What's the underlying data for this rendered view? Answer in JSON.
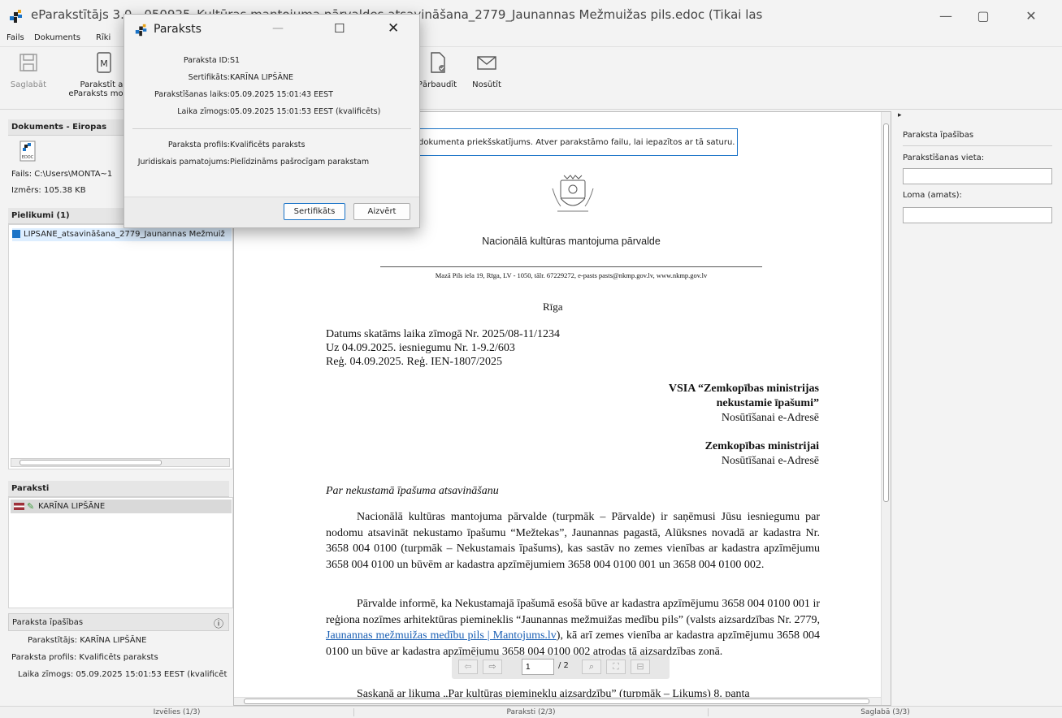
{
  "window": {
    "title": "eParakstītājs 3.0 - 050925_Kultūras mantojuma pārvaldes atsavināšana_2779_Jaunannas Mežmuižas pils.edoc (Tikai lasāms)"
  },
  "menu": [
    "Fails",
    "Dokuments",
    "Rīki"
  ],
  "toolbar": {
    "save": "Saglabāt",
    "sign_line1": "Parakstīt ar",
    "sign_line2": "eParaksts mobile",
    "verify": "Pārbaudīt",
    "send": "Nosūtīt"
  },
  "left": {
    "doc_header": "Dokuments - Eiropas",
    "file_label": "Fails:",
    "file_value": "C:\\Users\\MONTA~1",
    "size_label": "Izmērs:",
    "size_value": "105.38 KB",
    "attachments_header": "Pielikumi (1)",
    "attachment_file": "LIPSANE_atsavināšana_2779_Jaunannas Mežmuiž",
    "signatures_header": "Paraksti",
    "signer": "KARĪNA LIPŠĀNE",
    "props_header": "Paraksta īpašības",
    "props": [
      {
        "label": "Parakstītājs:",
        "value": "KARĪNA LIPŠĀNE"
      },
      {
        "label": "Paraksta profils:",
        "value": "Kvalificēts paraksts"
      },
      {
        "label": "Laika zīmogs:",
        "value": "05.09.2025 15:01:53 EEST (kvalificēt"
      }
    ]
  },
  "doc": {
    "banner": "dokumenta priekšskatījums. Atver parakstāmo failu, lai iepazītos ar tā saturu.",
    "org": "Nacionālā kultūras mantojuma pārvalde",
    "address": "Mazā Pils iela 19, Rīga, LV - 1050, tālr. 67229272, e-pasts pasts@nkmp.gov.lv, www.nkmp.gov.lv",
    "city": "Rīga",
    "date_line": "Datums skatāms laika zīmogā Nr. 2025/08-11/1234",
    "ref1": "Uz 04.09.2025. iesniegumu  Nr. 1-9.2/603",
    "ref2": "Reģ. 04.09.2025. Reģ. IEN-1807/2025",
    "recipient1_line1": "VSIA “Zemkopības ministrijas",
    "recipient1_line2": "nekustamie īpašumi”",
    "recipient1_line3": "Nosūtīšanai e-Adresē",
    "recipient2_line1": "Zemkopības ministrijai",
    "recipient2_line2": "Nosūtīšanai e-Adresē",
    "subject": "Par nekustamā  īpašuma atsavināšanu",
    "para1": "Nacionālā kultūras mantojuma pārvalde (turpmāk – Pārvalde) ir saņēmusi Jūsu iesniegumu par nodomu atsavināt nekustamo īpašumu “Mežtekas”, Jaunannas pagastā, Alūksnes novadā ar kadastra Nr. 3658 004 0100  (turpmāk – Nekustamais īpašums), kas sastāv no zemes vienības ar kadastra apzīmējumu 3658 004 0100 un būvēm ar kadastra apzīmējumiem  3658 004 0100 001 un 3658 004 0100 002.",
    "para2_start": "Pārvalde informē, ka Nekustamajā īpašumā esošā būve ar kadastra apzīmējumu 3658 004 0100 001 ir reģiona nozīmes arhitektūras piemineklis “Jaunannas mežmuižas medību pils” (valsts aizsardzības Nr. 2779, ",
    "para2_link": "Jaunannas mežmuižas medību pils | Mantojums.lv",
    "para2_end": "), kā arī zemes vienība ar kadastra apzīmējumu 3658 004 0100 un būve ar kadastra apzīmējumu 3658 004 0100 002 atrodas tā aizsardzības zonā.",
    "para3_cut": "Saskaņā ar likuma „Par kultūras pieminekļu aizsardzību” (turpmāk – Likums) 8. panta",
    "page_current": "1",
    "page_total": "/ 2"
  },
  "right": {
    "header": "Paraksta īpašības",
    "place_label": "Parakstīšanas vieta:",
    "role_label": "Loma (amats):"
  },
  "status": {
    "step1": "Izvēlies (1/3)",
    "step2": "Paraksti (2/3)",
    "step3": "Saglabā (3/3)"
  },
  "dialog": {
    "title": "Paraksts",
    "rows": [
      {
        "label": "Paraksta ID:",
        "value": "S1"
      },
      {
        "label": "Sertifikāts:",
        "value": "KARĪNA LIPŠĀNE"
      },
      {
        "label": "Parakstīšanas laiks:",
        "value": "05.09.2025 15:01:43 EEST"
      },
      {
        "label": "Laika zīmogs:",
        "value": "05.09.2025 15:01:53 EEST (kvalificēts)"
      },
      {
        "label": "Paraksta profils:",
        "value": "Kvalificēts paraksts"
      },
      {
        "label": "Juridiskais pamatojums:",
        "value": "Pielīdzināms pašrocīgam parakstam"
      }
    ],
    "cert_button": "Sertifikāts",
    "close_button": "Aizvērt"
  },
  "colors": {
    "accent": "#1a73c7",
    "link": "#1a5fb4"
  }
}
